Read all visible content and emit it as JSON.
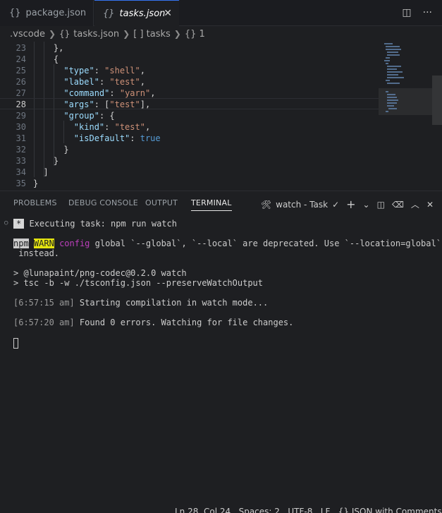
{
  "tabs": [
    {
      "label": "package.json",
      "icon": "braces-icon"
    },
    {
      "label": "tasks.json",
      "icon": "braces-icon",
      "close": "✕"
    }
  ],
  "tab_actions": {
    "split": "▯▯",
    "more": "···"
  },
  "breadcrumb": {
    "folder": ".vscode",
    "file": "tasks.json",
    "array": "[ ] tasks",
    "object": "{} 1"
  },
  "editor": {
    "line_numbers": [
      "23",
      "24",
      "25",
      "26",
      "27",
      "28",
      "29",
      "30",
      "31",
      "32",
      "33",
      "34",
      "35"
    ],
    "active_line": "28"
  },
  "panel": {
    "tabs": [
      "PROBLEMS",
      "DEBUG CONSOLE",
      "OUTPUT",
      "TERMINAL"
    ],
    "active_tab": "TERMINAL",
    "task_label": "watch - Task",
    "actions": {
      "check": "✓",
      "add": "+",
      "chevron": "⌄",
      "split": "◫",
      "trash": "🗑",
      "up": "︿",
      "close": "✕"
    }
  },
  "terminal": {
    "star": "*",
    "executing": " Executing task: npm run watch",
    "npm": "npm",
    "warn": "WARN",
    "config": "config",
    "warn_rest": " global `--global`, `--local` are deprecated. Use `--location=global`",
    "instead": " instead.",
    "cmd1": "> @lunapaint/png-codec@0.2.0 watch",
    "cmd2": "> tsc -b -w ./tsconfig.json --preserveWatchOutput",
    "ts1": "[6:57:15 am]",
    "msg1": " Starting compilation in watch mode...",
    "ts2": "[6:57:20 am]",
    "msg2": " Found 0 errors. Watching for file changes."
  },
  "status": {
    "text": "Ln 28, Col 24   Spaces: 2   UTF-8   LF   {} JSON with Comments"
  }
}
